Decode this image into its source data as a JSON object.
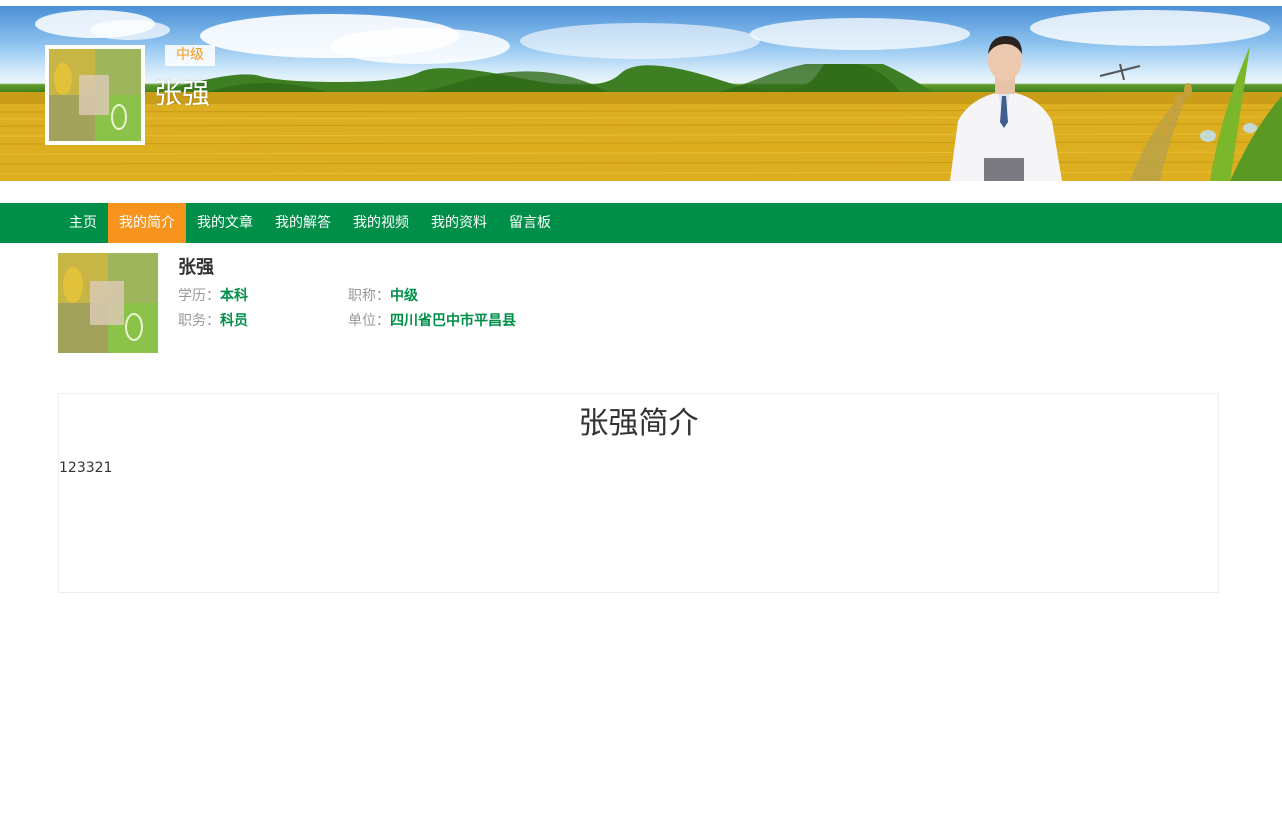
{
  "header": {
    "level_badge": "中级",
    "name": "张强"
  },
  "nav": {
    "items": [
      {
        "label": "主页"
      },
      {
        "label": "我的简介"
      },
      {
        "label": "我的文章"
      },
      {
        "label": "我的解答"
      },
      {
        "label": "我的视频"
      },
      {
        "label": "我的资料"
      },
      {
        "label": "留言板"
      }
    ],
    "active_index": 1
  },
  "profile": {
    "name": "张强",
    "education_label": "学历：",
    "education_value": "本科",
    "title_label": "职称：",
    "title_value": "中级",
    "position_label": "职务：",
    "position_value": "科员",
    "unit_label": "单位：",
    "unit_value": "四川省巴中市平昌县"
  },
  "intro": {
    "title": "张强简介",
    "text": "123321"
  },
  "colors": {
    "brand_green": "#008f49",
    "accent_orange": "#f7941d",
    "badge_orange": "#f39a1e"
  }
}
